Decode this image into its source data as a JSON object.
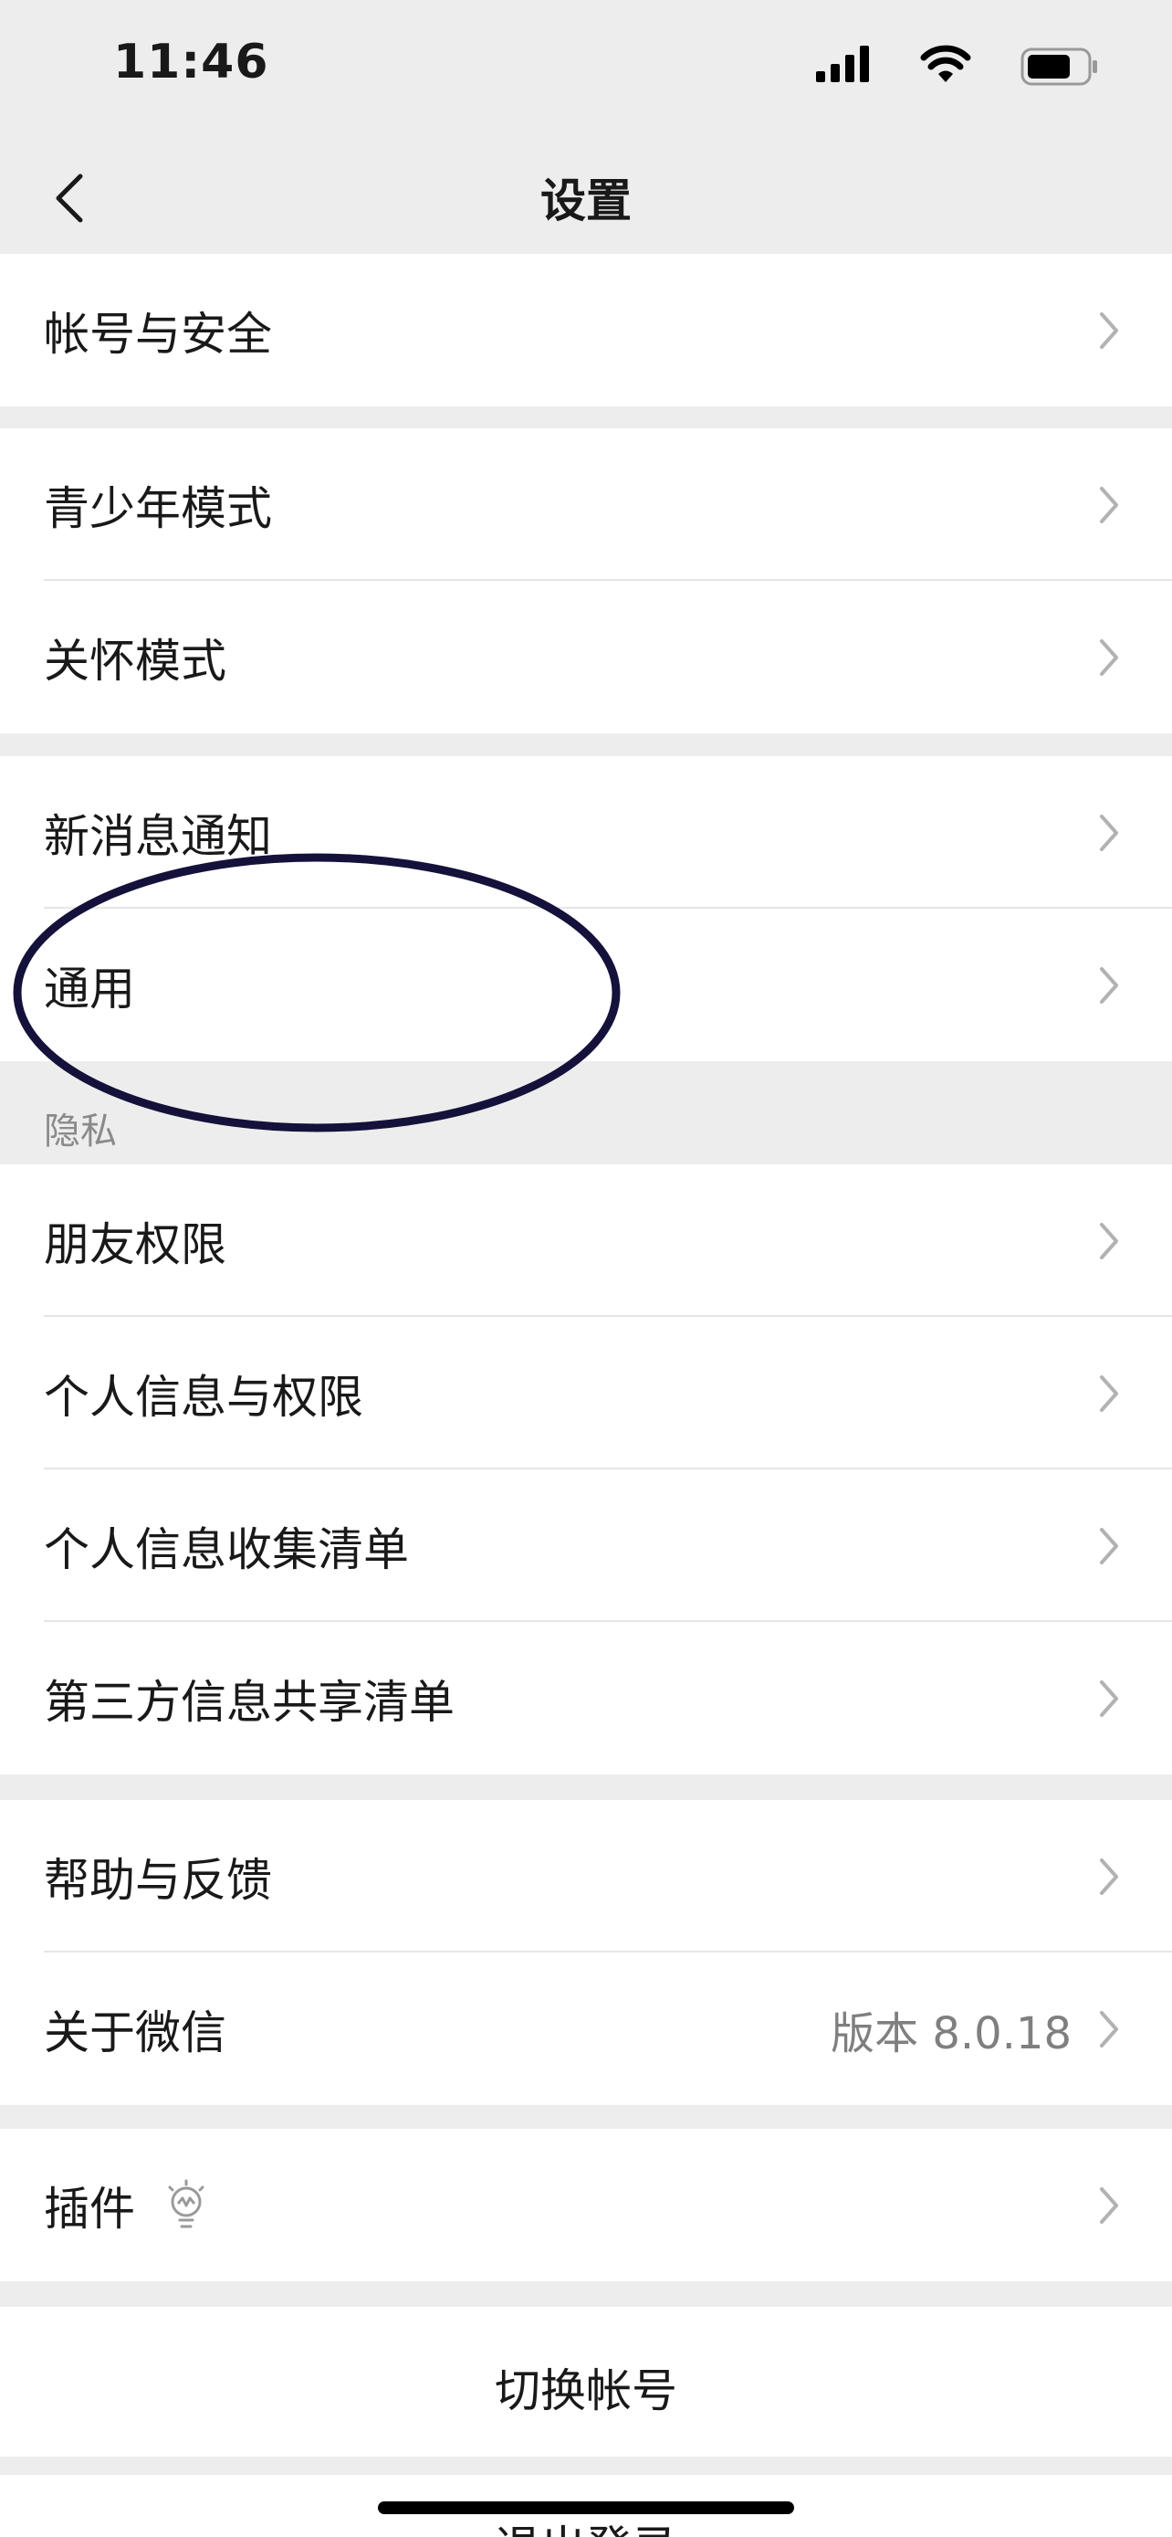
{
  "status_bar": {
    "time": "11:46"
  },
  "nav": {
    "title": "设置"
  },
  "groups": {
    "g1": {
      "items": [
        {
          "label": "帐号与安全"
        }
      ]
    },
    "g2": {
      "items": [
        {
          "label": "青少年模式"
        },
        {
          "label": "关怀模式"
        }
      ]
    },
    "g3": {
      "items": [
        {
          "label": "新消息通知"
        },
        {
          "label": "通用"
        }
      ]
    },
    "privacy": {
      "header": "隐私",
      "items": [
        {
          "label": "朋友权限"
        },
        {
          "label": "个人信息与权限"
        },
        {
          "label": "个人信息收集清单"
        },
        {
          "label": "第三方信息共享清单"
        }
      ]
    },
    "g5": {
      "items": [
        {
          "label": "帮助与反馈"
        },
        {
          "label": "关于微信",
          "value": "版本 8.0.18"
        }
      ]
    },
    "g6": {
      "items": [
        {
          "label": "插件",
          "icon": "lightbulb-icon"
        }
      ]
    }
  },
  "actions": {
    "switch_account": "切换帐号",
    "logout": "退出登录"
  },
  "colors": {
    "background": "#ededed",
    "cell": "#ffffff",
    "text": "#191919",
    "secondary": "#7f7f7f",
    "annotation": "#14113a"
  }
}
